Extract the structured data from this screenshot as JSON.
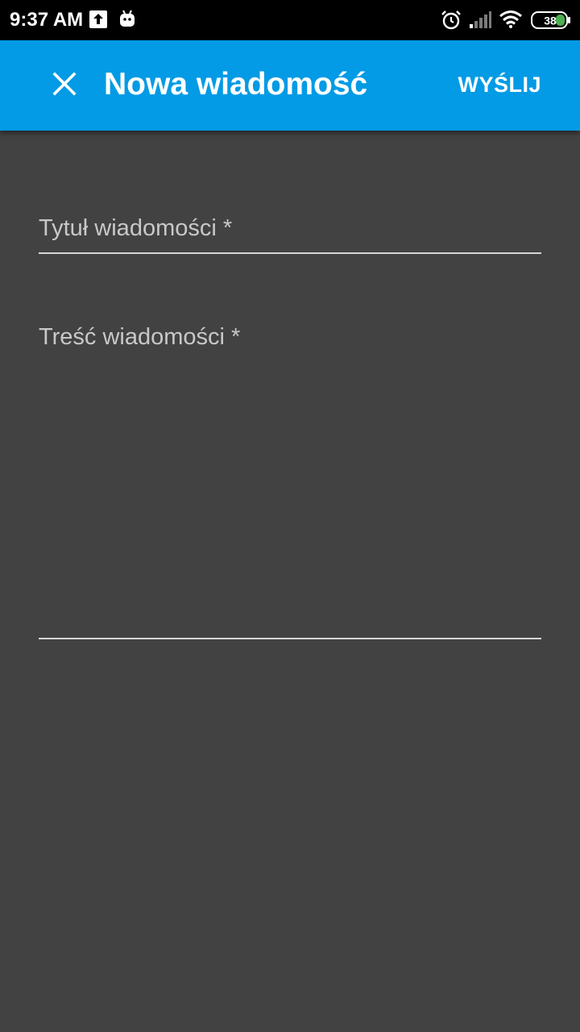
{
  "status_bar": {
    "time": "9:37 AM",
    "battery_level": "38",
    "icons": [
      "upload-icon",
      "android-icon",
      "alarm-icon",
      "signal-icon",
      "wifi-icon",
      "battery-icon"
    ]
  },
  "app_bar": {
    "close_icon": "close-icon",
    "title": "Nowa wiadomość",
    "send_label": "WYŚLIJ",
    "background_color": "#039be5"
  },
  "form": {
    "title_field": {
      "label": "Tytuł wiadomości *",
      "value": ""
    },
    "body_field": {
      "label": "Treść wiadomości *",
      "value": ""
    }
  },
  "colors": {
    "background": "#424242",
    "accent": "#039be5",
    "battery_fill": "#4caf50"
  }
}
